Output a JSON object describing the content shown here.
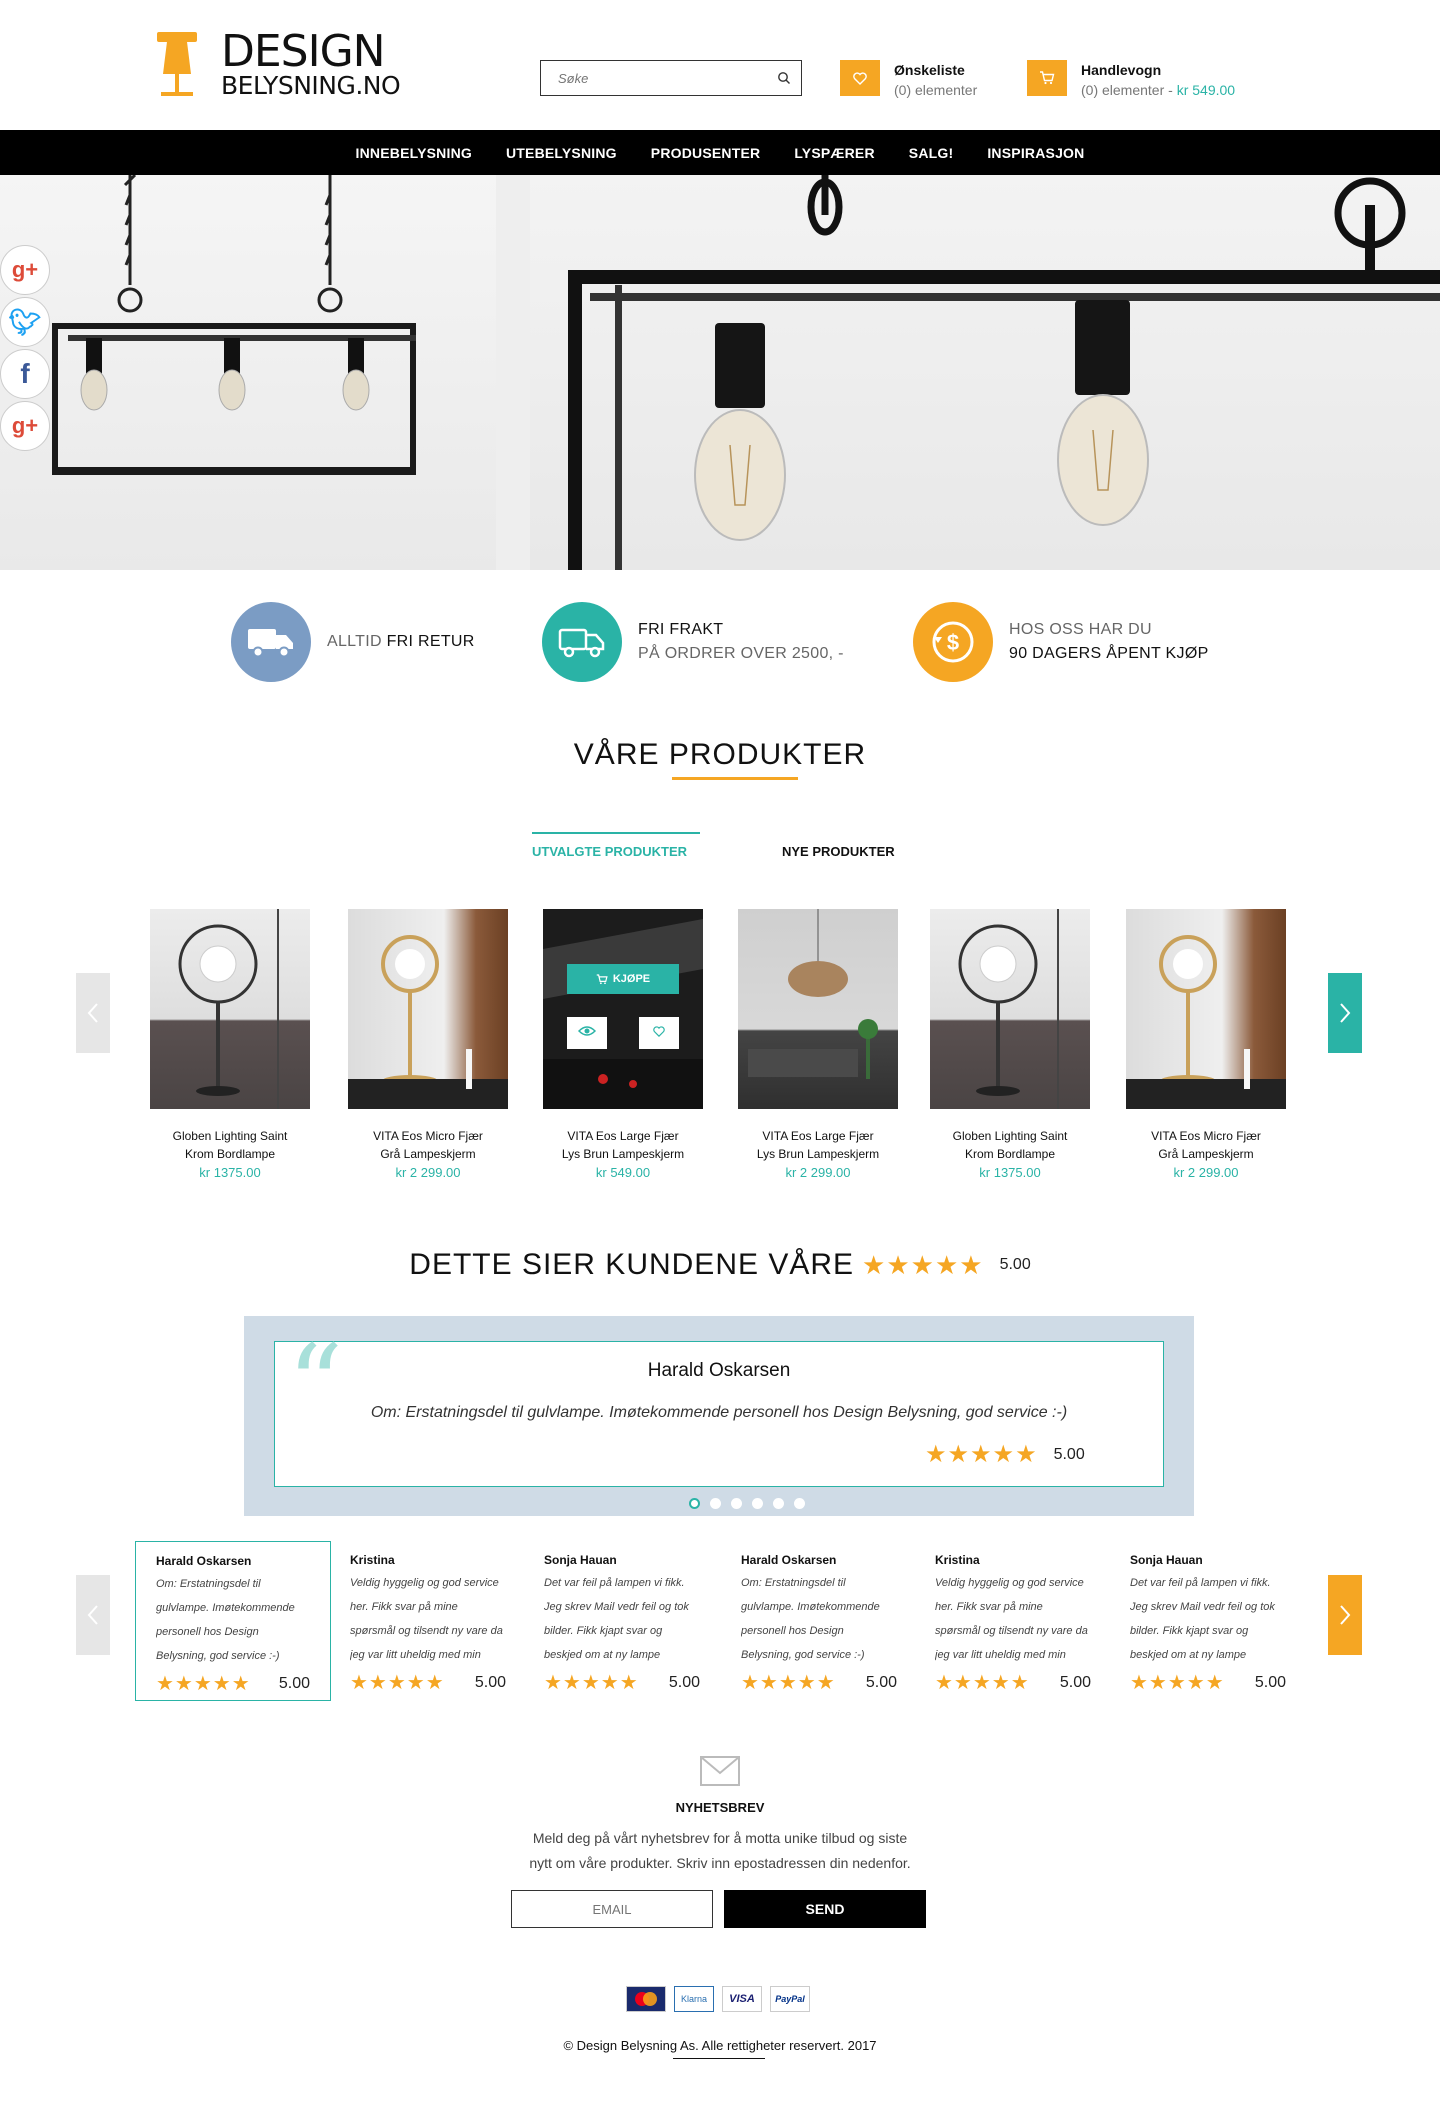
{
  "header": {
    "logo_line1": "DESIGN",
    "logo_line2": "BELYSNING.NO",
    "search_placeholder": "Søke",
    "wishlist_title": "Ønskeliste",
    "wishlist_sub": "(0) elementer",
    "cart_title": "Handlevogn",
    "cart_sub": "(0) elementer - ",
    "cart_amount": "kr 549.00"
  },
  "nav": [
    "INNEBELYSNING",
    "UTEBELYSNING",
    "PRODUSENTER",
    "LYSPÆRER",
    "SALG!",
    "INSPIRASJON"
  ],
  "features": [
    {
      "light": "ALLTID ",
      "bold": "FRI RETUR",
      "color": "#7b9cc4"
    },
    {
      "bold": "FRI FRAKT",
      "light": "PÅ ORDRER OVER 2500, -",
      "color": "#2ab3a6"
    },
    {
      "light": "HOS OSS HAR DU",
      "bold": "90 DAGERS ÅPENT KJØP",
      "color": "#f5a623"
    }
  ],
  "products_section": {
    "title_a": "VÅRE ",
    "title_b": "PRODUKTER",
    "tab_featured": "UTVALGTE PRODUKTER",
    "tab_new": "NYE PRODUKTER",
    "buy_label": "KJØPE",
    "items": [
      {
        "name1": "Globen Lighting Saint",
        "name2": "Krom Bordlampe",
        "price": "kr 1375.00"
      },
      {
        "name1": "VITA Eos Micro Fjær",
        "name2": "Grå Lampeskjerm",
        "price": "kr 2 299.00"
      },
      {
        "name1": "VITA Eos Large Fjær",
        "name2": "Lys Brun Lampeskjerm",
        "price": "kr 549.00"
      },
      {
        "name1": "VITA Eos Large Fjær",
        "name2": "Lys Brun Lampeskjerm",
        "price": "kr 2 299.00"
      },
      {
        "name1": "Globen Lighting Saint",
        "name2": "Krom Bordlampe",
        "price": "kr 1375.00"
      },
      {
        "name1": "VITA Eos Micro Fjær",
        "name2": "Grå Lampeskjerm",
        "price": "kr 2 299.00"
      }
    ]
  },
  "reviews_section": {
    "title": "DETTE SIER KUNDENE VÅRE",
    "stars": "★★★★★",
    "score": "5.00",
    "featured": {
      "name": "Harald Oskarsen",
      "text": "Om: Erstatningsdel til gulvlampe. Imøtekommende personell hos Design Belysning, god service :-)",
      "stars": "★★★★★",
      "score": "5.00"
    },
    "cards": [
      {
        "name": "Harald Oskarsen",
        "text": "Om: Erstatningsdel til gulvlampe. Imøtekommende personell hos Design Belysning, god service :-)",
        "stars": "★★★★★",
        "score": "5.00"
      },
      {
        "name": "Kristina",
        "text": "Veldig hyggelig og god service her. Fikk svar på mine spørsmål og tilsendt ny vare da jeg var litt uheldig med min",
        "stars": "★★★★★",
        "score": "5.00"
      },
      {
        "name": "Sonja Hauan",
        "text": "Det var feil på lampen vi fikk. Jeg skrev Mail vedr feil og tok bilder. Fikk kjapt svar og beskjed om at ny lampe",
        "stars": "★★★★★",
        "score": "5.00"
      },
      {
        "name": "Harald Oskarsen",
        "text": "Om: Erstatningsdel til gulvlampe. Imøtekommende personell hos Design Belysning, god service :-)",
        "stars": "★★★★★",
        "score": "5.00"
      },
      {
        "name": "Kristina",
        "text": "Veldig hyggelig og god service her. Fikk svar på mine spørsmål og tilsendt ny vare da jeg var litt uheldig med min",
        "stars": "★★★★★",
        "score": "5.00"
      },
      {
        "name": "Sonja Hauan",
        "text": "Det var feil på lampen vi fikk. Jeg skrev Mail vedr feil og tok bilder. Fikk kjapt svar og beskjed om at ny lampe",
        "stars": "★★★★★",
        "score": "5.00"
      }
    ]
  },
  "newsletter": {
    "title": "NYHETSBREV",
    "line1": "Meld deg på vårt nyhetsbrev for å motta unike tilbud og siste",
    "line2": "nytt om våre produkter. Skriv inn epostadressen din nedenfor.",
    "email_placeholder": "EMAIL",
    "send_label": "SEND"
  },
  "footer": {
    "payments": [
      "MasterCard",
      "Klarna",
      "VISA",
      "PayPal"
    ],
    "copyright": "© Design Belysning As. Alle rettigheter reservert. 2017"
  },
  "colors": {
    "accent": "#2ab3a6",
    "orange": "#f5a623",
    "nav": "#000000",
    "review_bg": "#cfdbe6"
  }
}
